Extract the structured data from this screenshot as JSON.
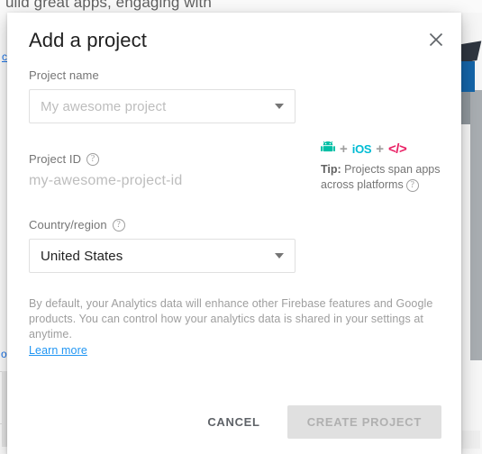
{
  "background": {
    "top_text": "uild great apps, engaging with",
    "left_link": "c",
    "left_link_2": "o"
  },
  "dialog": {
    "title": "Add a project",
    "close_icon": "close-icon",
    "project_name": {
      "label": "Project name",
      "placeholder": "My awesome project",
      "value": "My awesome project"
    },
    "project_id": {
      "label": "Project ID",
      "help_icon": "help-icon",
      "value": "my-awesome-project-id"
    },
    "country_region": {
      "label": "Country/region",
      "help_icon": "help-icon",
      "value": "United States"
    },
    "tip": {
      "android_icon": "android-icon",
      "plus_1": "+",
      "ios_label": "iOS",
      "plus_2": "+",
      "code_label": "</>",
      "prefix": "Tip:",
      "text": " Projects span apps across platforms",
      "help_icon": "help-icon"
    },
    "disclaimer": {
      "text": "By default, your Analytics data will enhance other Firebase features and Google products. You can control how your analytics data is shared in your settings at anytime.",
      "link": "Learn more"
    },
    "footer": {
      "cancel_label": "CANCEL",
      "create_label": "CREATE PROJECT"
    }
  },
  "colors": {
    "android_teal": "#00bfa5",
    "ios_cyan": "#00bcd4",
    "code_crimson": "#e91e63",
    "link_blue": "#2196f3",
    "disabled_bg": "#e0e0e0"
  }
}
